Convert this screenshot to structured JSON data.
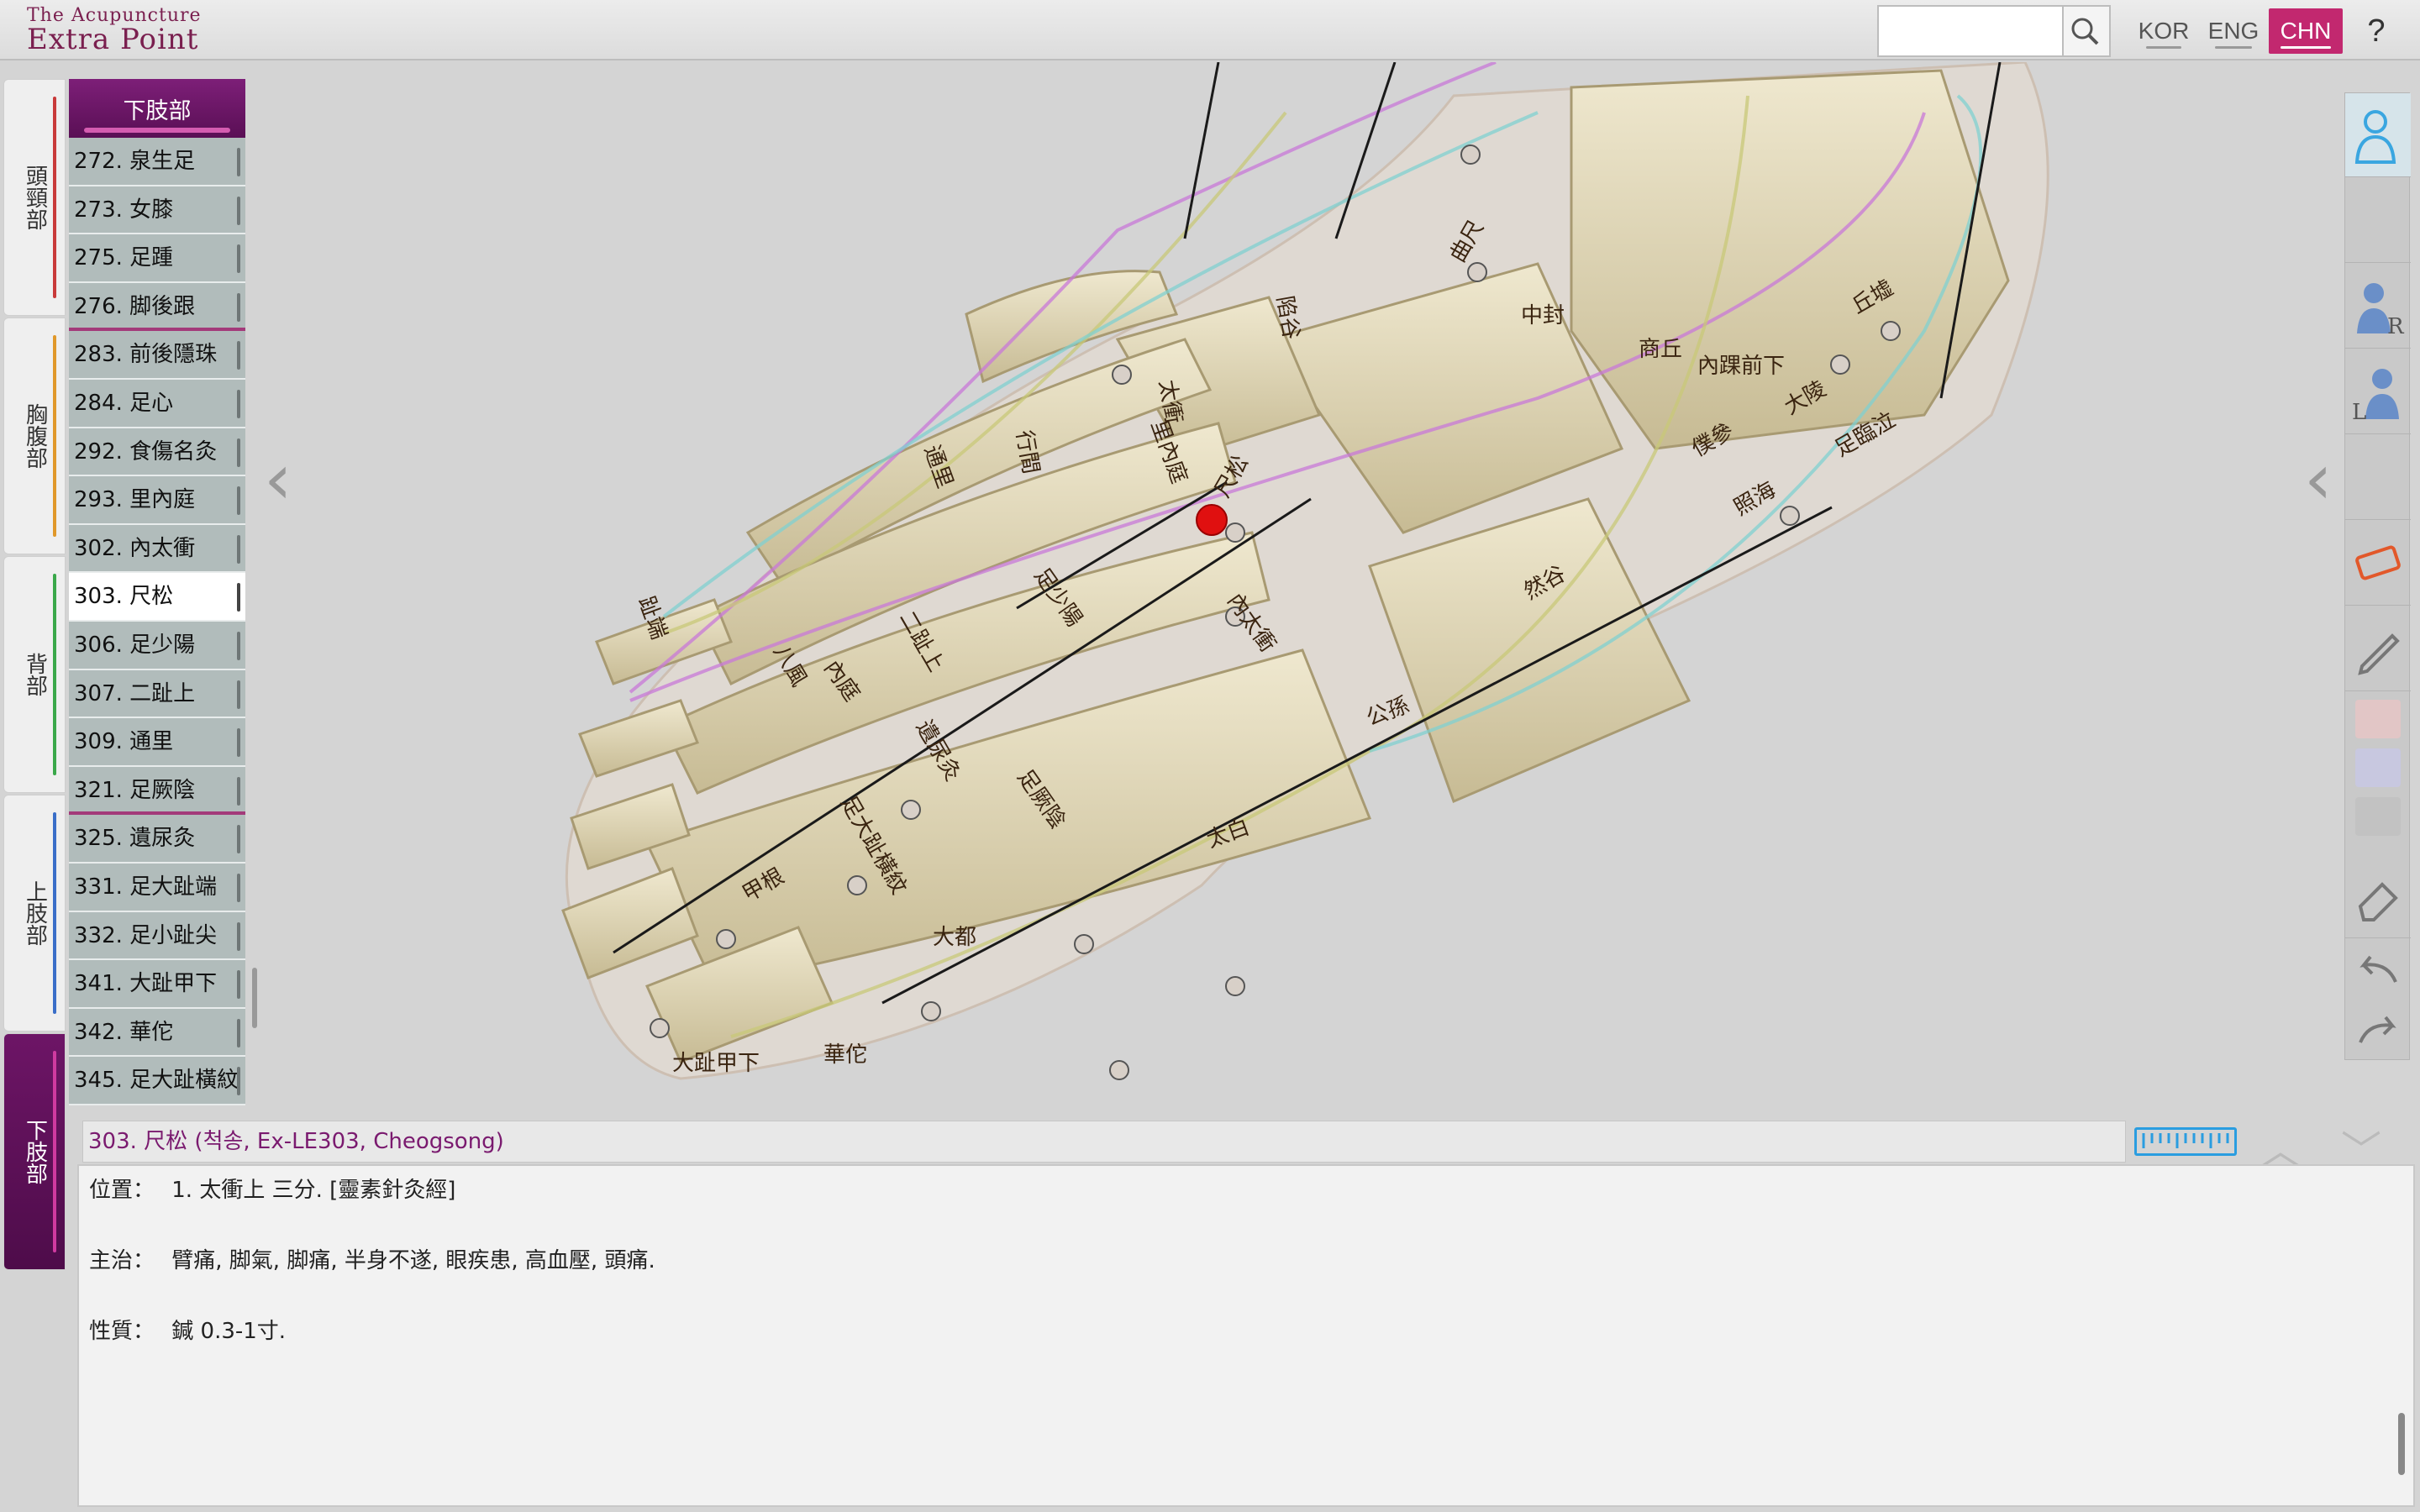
{
  "app": {
    "logo_line1": "The Acupuncture",
    "logo_line2": "Extra Point"
  },
  "search": {
    "placeholder": ""
  },
  "languages": [
    {
      "label": "KOR",
      "active": false
    },
    {
      "label": "ENG",
      "active": false
    },
    {
      "label": "CHN",
      "active": true
    }
  ],
  "help_label": "?",
  "body_tabs": [
    {
      "label": "頭頸部",
      "color": "#c83a3a",
      "active": false
    },
    {
      "label": "胸腹部",
      "color": "#e0982a",
      "active": false
    },
    {
      "label": "背部",
      "color": "#3aa84a",
      "active": false
    },
    {
      "label": "上肢部",
      "color": "#3a6ec8",
      "active": false
    },
    {
      "label": "下肢部",
      "color": "#d03aa0",
      "active": true
    }
  ],
  "list": {
    "header": "下肢部",
    "items": [
      "272. 泉生足",
      "273. 女膝",
      "275. 足踵",
      "276. 脚後跟",
      "283. 前後隱珠",
      "284. 足心",
      "292. 食傷名灸",
      "293. 里內庭",
      "302. 內太衝",
      "303. 尺松",
      "306. 足少陽",
      "307. 二趾上",
      "309. 通里",
      "321. 足厥陰",
      "325. 遺尿灸",
      "331. 足大趾端",
      "332. 足小趾尖",
      "341. 大趾甲下",
      "342. 華佗",
      "345. 足大趾橫紋"
    ],
    "selected_index": 9
  },
  "viewer_labels": [
    "尺松",
    "內太衝",
    "足少陽",
    "二趾上",
    "足厥陰",
    "遺尿灸",
    "足大趾橫紋",
    "甲根",
    "大趾甲下",
    "華佗",
    "大都",
    "太白",
    "公孫",
    "然谷",
    "照海",
    "中封",
    "商丘",
    "內踝前下",
    "曲尺",
    "太衝",
    "行間",
    "八風",
    "內庭",
    "陷谷",
    "通里",
    "趾端",
    "足臨泣",
    "丘墟",
    "大陵",
    "僕參",
    "里內庭"
  ],
  "tools": {
    "color_swatches": [
      "#e2c6c6",
      "#c8c8e0",
      "#c2c2c2"
    ]
  },
  "detail": {
    "title": "303. 尺松 (척송, Ex-LE303, Cheogsong)",
    "position_label": "位置：",
    "position_text": "1. 太衝上 三分. [靈素針灸經]",
    "indication_label": "主治：",
    "indication_text": "臂痛, 脚氣, 脚痛, 半身不遂, 眼疾患, 高血壓, 頭痛.",
    "nature_label": "性質：",
    "nature_text": "鍼 0.3-1寸."
  }
}
